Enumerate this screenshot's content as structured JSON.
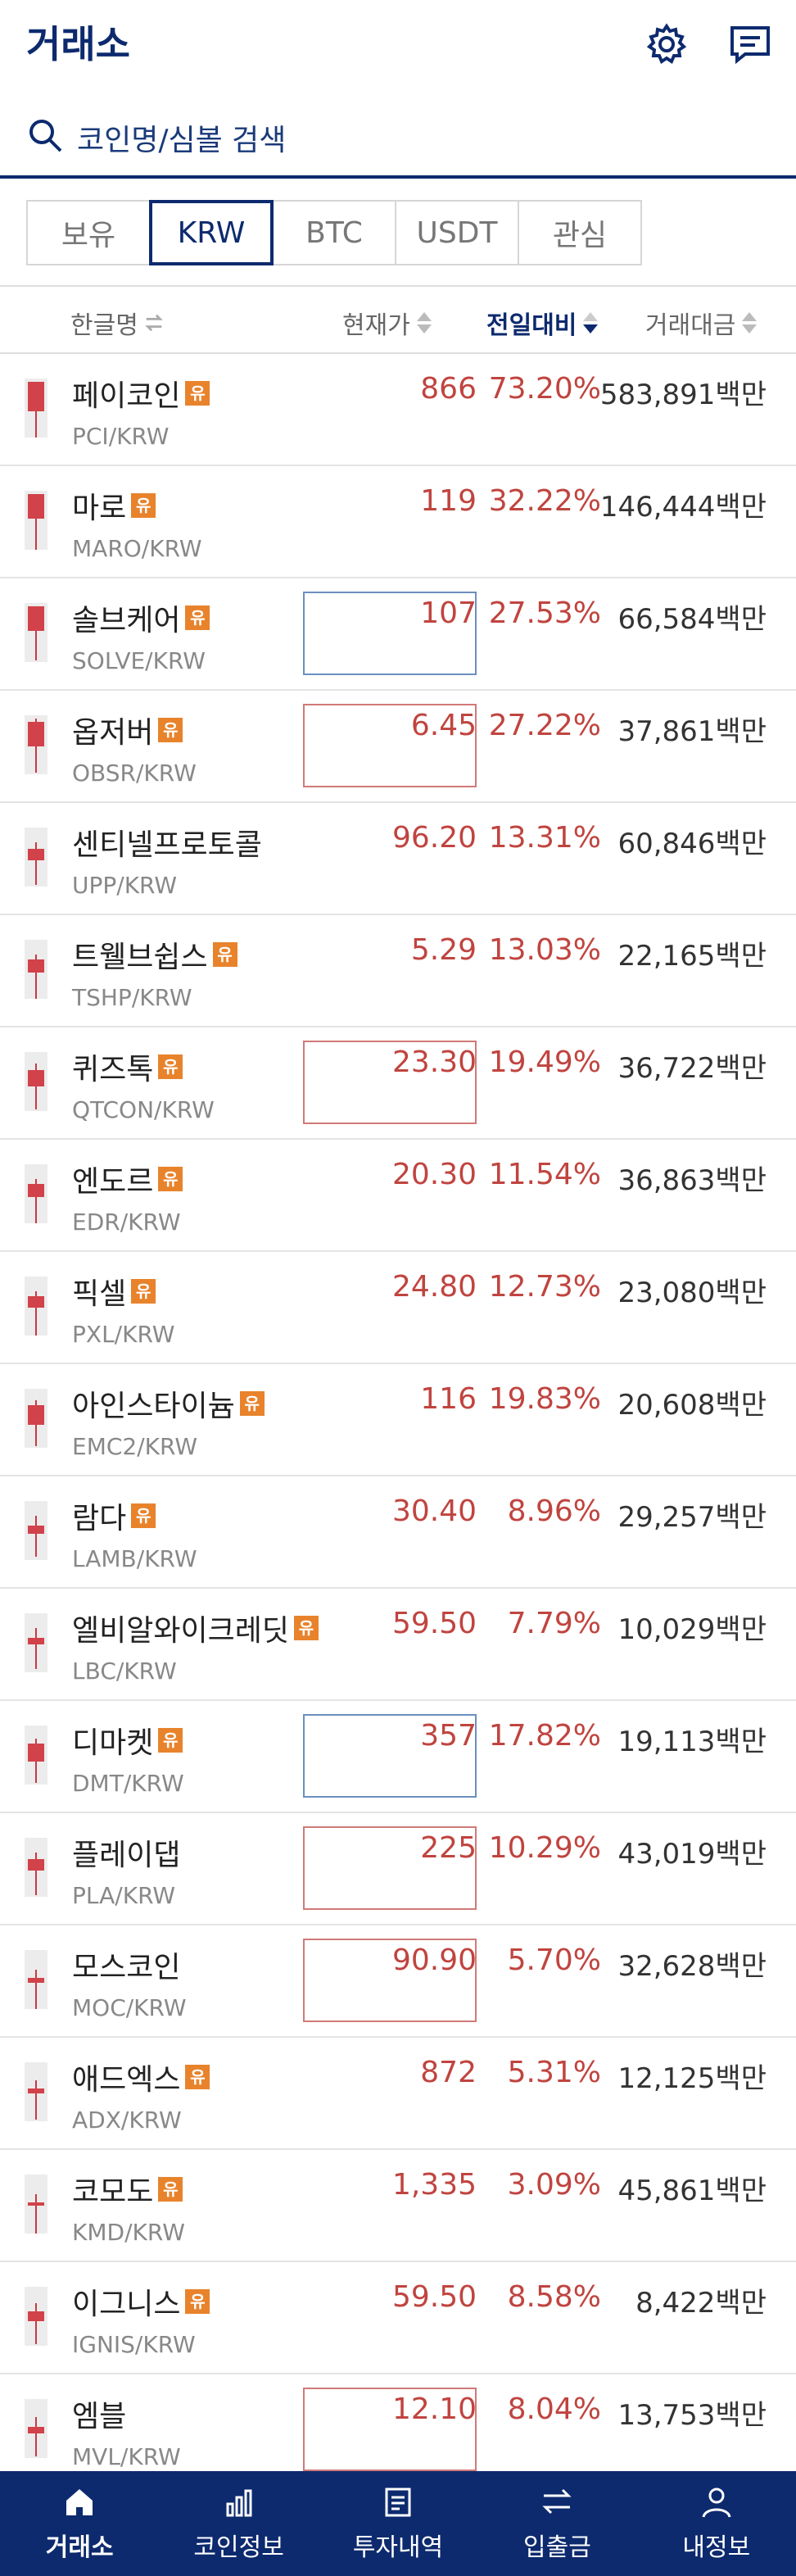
{
  "header": {
    "title": "거래소",
    "settings_icon": "gear-icon",
    "message_icon": "chat-icon"
  },
  "search": {
    "placeholder": "코인명/심볼 검색"
  },
  "tabs": [
    "보유",
    "KRW",
    "BTC",
    "USDT",
    "관심"
  ],
  "active_tab": "KRW",
  "columns": {
    "name": "한글명",
    "price": "현재가",
    "change": "전일대비",
    "volume": "거래대금"
  },
  "rows": [
    {
      "name": "페이코인",
      "badge": "유",
      "symbol": "PCI/KRW",
      "price": "866",
      "change": "73.20%",
      "volume": "583,891백만",
      "box": "none"
    },
    {
      "name": "마로",
      "badge": "유",
      "symbol": "MARO/KRW",
      "price": "119",
      "change": "32.22%",
      "volume": "146,444백만",
      "box": "none"
    },
    {
      "name": "솔브케어",
      "badge": "유",
      "symbol": "SOLVE/KRW",
      "price": "107",
      "change": "27.53%",
      "volume": "66,584백만",
      "box": "blue"
    },
    {
      "name": "옵저버",
      "badge": "유",
      "symbol": "OBSR/KRW",
      "price": "6.45",
      "change": "27.22%",
      "volume": "37,861백만",
      "box": "red"
    },
    {
      "name": "센티넬프로토콜",
      "badge": "",
      "symbol": "UPP/KRW",
      "price": "96.20",
      "change": "13.31%",
      "volume": "60,846백만",
      "box": "none"
    },
    {
      "name": "트웰브쉽스",
      "badge": "유",
      "symbol": "TSHP/KRW",
      "price": "5.29",
      "change": "13.03%",
      "volume": "22,165백만",
      "box": "none"
    },
    {
      "name": "퀴즈톡",
      "badge": "유",
      "symbol": "QTCON/KRW",
      "price": "23.30",
      "change": "19.49%",
      "volume": "36,722백만",
      "box": "red"
    },
    {
      "name": "엔도르",
      "badge": "유",
      "symbol": "EDR/KRW",
      "price": "20.30",
      "change": "11.54%",
      "volume": "36,863백만",
      "box": "none"
    },
    {
      "name": "픽셀",
      "badge": "유",
      "symbol": "PXL/KRW",
      "price": "24.80",
      "change": "12.73%",
      "volume": "23,080백만",
      "box": "none"
    },
    {
      "name": "아인스타이늄",
      "badge": "유",
      "symbol": "EMC2/KRW",
      "price": "116",
      "change": "19.83%",
      "volume": "20,608백만",
      "box": "none"
    },
    {
      "name": "람다",
      "badge": "유",
      "symbol": "LAMB/KRW",
      "price": "30.40",
      "change": "8.96%",
      "volume": "29,257백만",
      "box": "none"
    },
    {
      "name": "엘비알와이크레딧",
      "badge": "유",
      "symbol": "LBC/KRW",
      "price": "59.50",
      "change": "7.79%",
      "volume": "10,029백만",
      "box": "none"
    },
    {
      "name": "디마켓",
      "badge": "유",
      "symbol": "DMT/KRW",
      "price": "357",
      "change": "17.82%",
      "volume": "19,113백만",
      "box": "blue"
    },
    {
      "name": "플레이댑",
      "badge": "",
      "symbol": "PLA/KRW",
      "price": "225",
      "change": "10.29%",
      "volume": "43,019백만",
      "box": "red"
    },
    {
      "name": "모스코인",
      "badge": "",
      "symbol": "MOC/KRW",
      "price": "90.90",
      "change": "5.70%",
      "volume": "32,628백만",
      "box": "red"
    },
    {
      "name": "애드엑스",
      "badge": "유",
      "symbol": "ADX/KRW",
      "price": "872",
      "change": "5.31%",
      "volume": "12,125백만",
      "box": "none"
    },
    {
      "name": "코모도",
      "badge": "유",
      "symbol": "KMD/KRW",
      "price": "1,335",
      "change": "3.09%",
      "volume": "45,861백만",
      "box": "none"
    },
    {
      "name": "이그니스",
      "badge": "유",
      "symbol": "IGNIS/KRW",
      "price": "59.50",
      "change": "8.58%",
      "volume": "8,422백만",
      "box": "none"
    },
    {
      "name": "엠블",
      "badge": "",
      "symbol": "MVL/KRW",
      "price": "12.10",
      "change": "8.04%",
      "volume": "13,753백만",
      "box": "red"
    }
  ],
  "bottom_nav": [
    {
      "label": "거래소",
      "icon": "home-icon",
      "active": true
    },
    {
      "label": "코인정보",
      "icon": "bar-chart-icon",
      "active": false
    },
    {
      "label": "투자내역",
      "icon": "document-icon",
      "active": false
    },
    {
      "label": "입출금",
      "icon": "transfer-icon",
      "active": false
    },
    {
      "label": "내정보",
      "icon": "user-icon",
      "active": false
    }
  ],
  "colors": {
    "brand": "#0d2a6e",
    "up": "#c0443f",
    "badge": "#e8832c"
  }
}
